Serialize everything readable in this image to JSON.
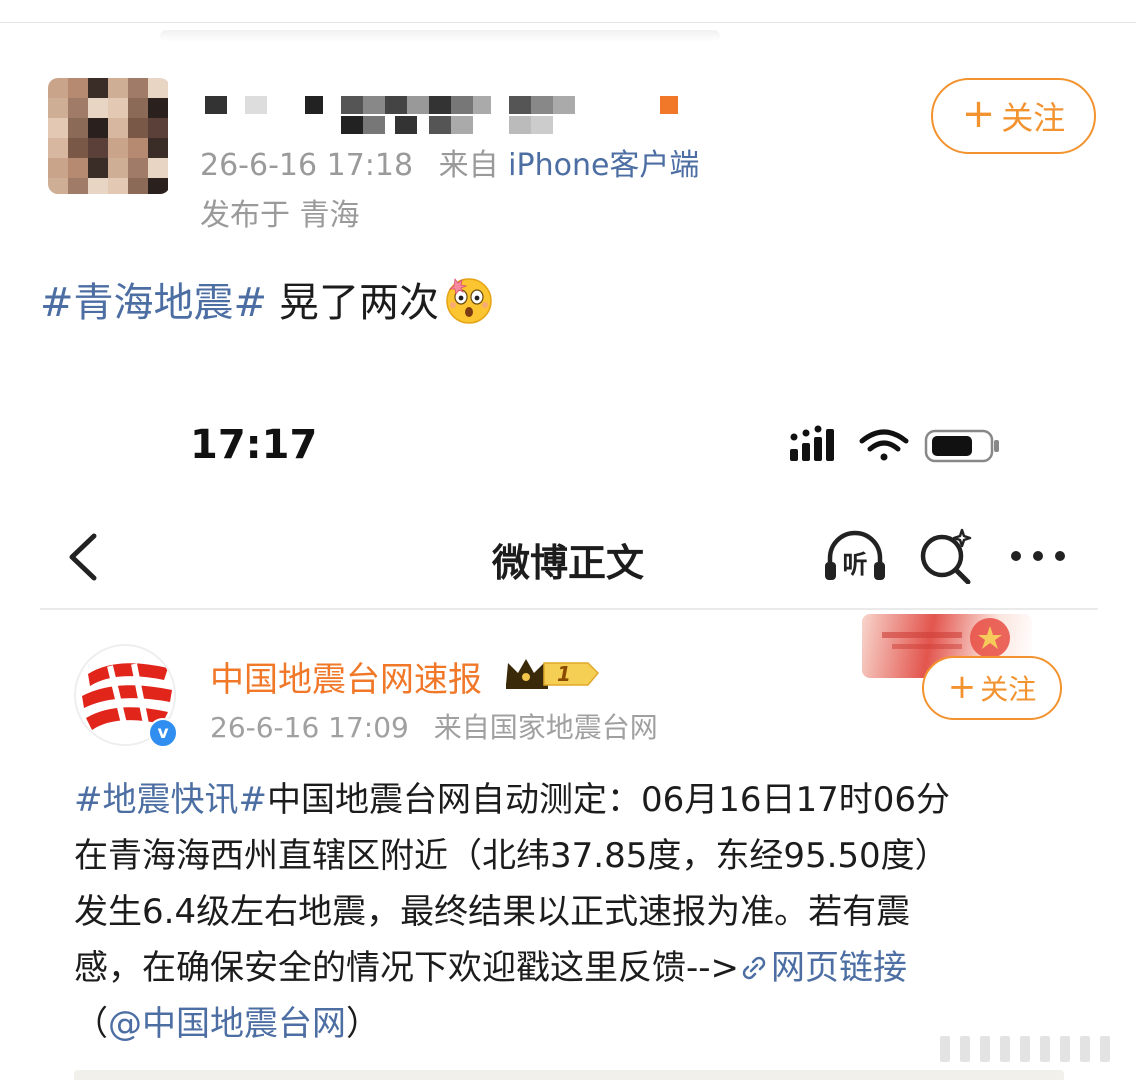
{
  "outer_post": {
    "timestamp": "26-6-16 17:18",
    "source_prefix": "来自",
    "source_name": "iPhone客户端",
    "location": "发布于 青海",
    "follow_label": "关注",
    "hashtag": "#青海地震#",
    "text": "晃了两次",
    "emoji": "flushed-shocked-emoji"
  },
  "embedded_screen": {
    "status_time": "17:17",
    "nav_title": "微博正文",
    "listen_label": "听",
    "post": {
      "author": "中国地震台网速报",
      "vip_level": "1",
      "timestamp": "26-6-16 17:09",
      "source": "来自国家地震台网",
      "follow_label": "关注",
      "lines": [
        {
          "hashtag": "#地震快讯#",
          "text": "中国地震台网自动测定：06月16日17时06分"
        },
        {
          "text": "在青海海西州直辖区附近（北纬37.85度，东经95.50度）"
        },
        {
          "text": "发生6.4级左右地震，最终结果以正式速报为准。若有震"
        },
        {
          "text": "感，在确保安全的情况下欢迎戳这里反馈-->",
          "link": "网页链接"
        },
        {
          "open": "（",
          "mention": "@中国地震台网",
          "close": "）"
        }
      ]
    }
  },
  "colors": {
    "link_blue": "#4c6ea3",
    "follow_orange": "#f29330",
    "name_orange": "#f07828",
    "meta_gray": "#9a9a9a"
  }
}
